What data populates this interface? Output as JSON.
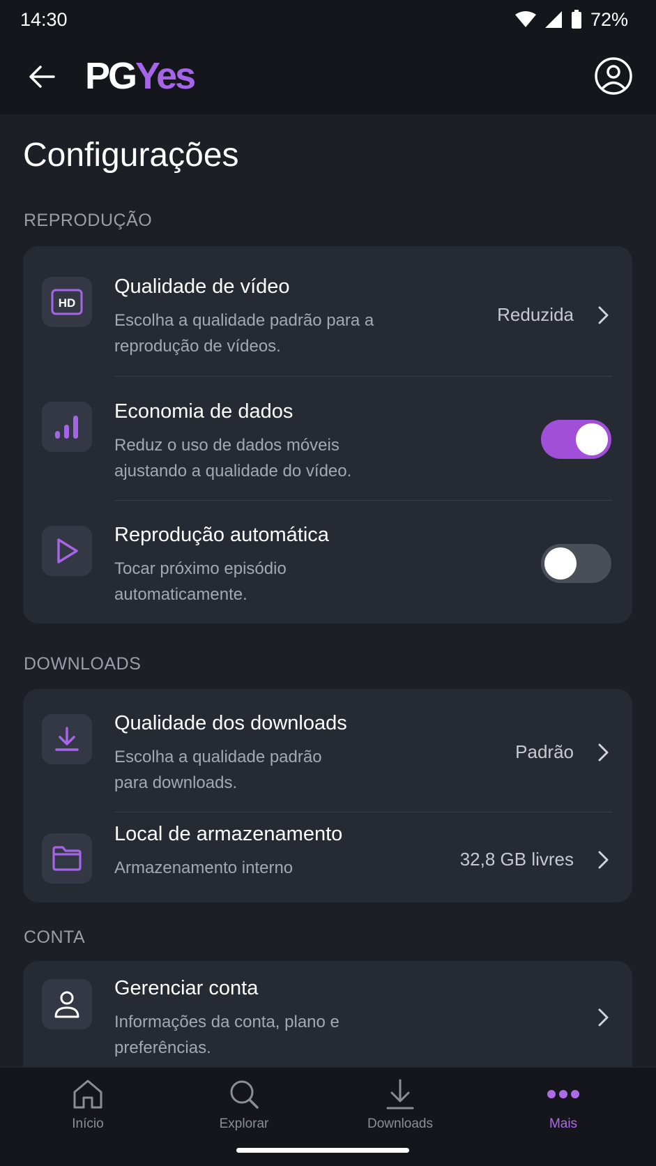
{
  "status_bar": {
    "time": "14:30",
    "battery": "72%"
  },
  "app_bar": {
    "logo_part1": "PG",
    "logo_part2": "Yes"
  },
  "page_title": "Configurações",
  "sections": {
    "playback": {
      "header": "REPRODUÇÃO",
      "video_quality": {
        "title": "Qualidade de vídeo",
        "description": "Escolha a qualidade padrão para a reprodução de vídeos.",
        "value": "Reduzida",
        "icon_text": "HD"
      },
      "data_saver": {
        "title": "Economia de dados",
        "description": "Reduz o uso de dados móveis ajustando a qualidade do vídeo.",
        "enabled": true
      },
      "autoplay": {
        "title": "Reprodução automática",
        "description": "Tocar próximo episódio automaticamente.",
        "enabled": false
      }
    },
    "downloads": {
      "header": "DOWNLOADS",
      "download_quality": {
        "title": "Qualidade dos downloads",
        "description": "Escolha a qualidade padrão para downloads.",
        "value": "Padrão"
      },
      "storage": {
        "title": "Local de armazenamento",
        "description": "Armazenamento interno",
        "value": "32,8 GB livres"
      }
    },
    "account": {
      "header": "CONTA",
      "manage": {
        "title": "Gerenciar conta",
        "description": "Informações da conta, plano e preferências."
      }
    }
  },
  "bottom_nav": {
    "home": "Início",
    "explore": "Explorar",
    "downloads": "Downloads",
    "more": "Mais",
    "active": "more"
  },
  "colors": {
    "accent": "#a465e6",
    "background": "#1c1f26",
    "card": "#262a33",
    "toggle_on": "#a14fd8"
  }
}
